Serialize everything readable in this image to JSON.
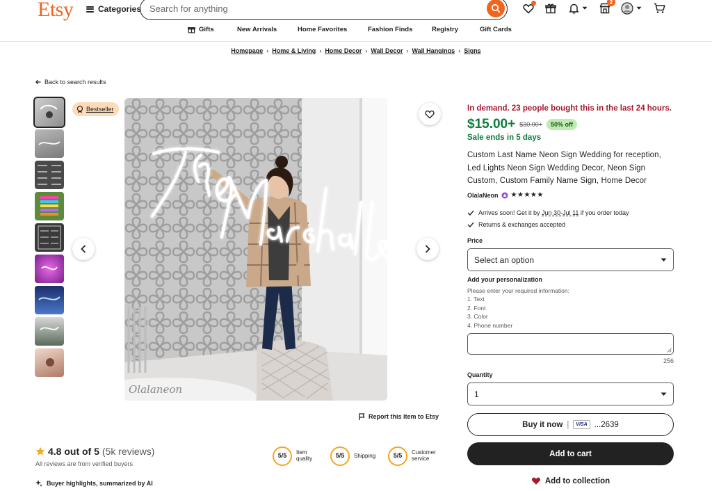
{
  "header": {
    "logo": "Etsy",
    "categories_label": "Categories",
    "search_placeholder": "Search for anything",
    "cart_count": "2"
  },
  "nav": {
    "items": [
      "Gifts",
      "New Arrivals",
      "Home Favorites",
      "Fashion Finds",
      "Registry",
      "Gift Cards"
    ]
  },
  "breadcrumb": [
    "Homepage",
    "Home & Living",
    "Home Decor",
    "Wall Decor",
    "Wall Hangings",
    "Signs"
  ],
  "back_link": "Back to search results",
  "gallery": {
    "bestseller": "Bestseller",
    "watermark": "Olalaneon",
    "sign_text": "The Marshalls"
  },
  "report_link": "Report this item to Etsy",
  "reviews": {
    "score": "4.8 out of 5",
    "count": "(5k reviews)",
    "verified": "All reviews are from verified buyers",
    "ai_highlights": "Buyer highlights, summarized by AI",
    "metrics": [
      {
        "value": "5/5",
        "label_line1": "Item",
        "label_line2": "quality"
      },
      {
        "value": "5/5",
        "label_line1": "Shipping",
        "label_line2": ""
      },
      {
        "value": "5/5",
        "label_line1": "Customer",
        "label_line2": "service"
      }
    ]
  },
  "product": {
    "demand": "In demand. 23 people bought this in the last 24 hours.",
    "price": "$15.00+",
    "old_price": "$30.00+",
    "discount": "50% off",
    "sale_ends": "Sale ends in 5 days",
    "title": "Custom Last Name Neon Sign Wedding for reception, Led Lights Neon Sign Wedding Decor, Neon Sign Custom, Custom Family Name Sign, Home Decor",
    "shop_name": "OlalaNeon",
    "stars": "★★★★★",
    "arrives_prefix": "Arrives soon! Get it by ",
    "arrives_dates": "Jun 30-Jul 11",
    "arrives_suffix": " if you order today",
    "returns": "Returns & exchanges accepted",
    "price_label": "Price",
    "price_select": "Select an option",
    "personalization_label": "Add your personalization",
    "personalization_instructions": [
      "Please enter your required information:",
      "1. Text",
      "2. Font",
      "3. Color",
      "4. Phone number"
    ],
    "char_count": "256",
    "quantity_label": "Quantity",
    "quantity_value": "1",
    "buy_now": "Buy it now",
    "card_brand": "VISA",
    "card_last4": "...2639",
    "add_to_cart": "Add to cart",
    "add_to_collection": "Add to collection"
  },
  "colors": {
    "brand": "#f1641e",
    "price_green": "#0e7d3a",
    "demand_red": "#a61a2e",
    "bestseller_bg": "#fddbb8",
    "discount_bg": "#bfeab2"
  }
}
